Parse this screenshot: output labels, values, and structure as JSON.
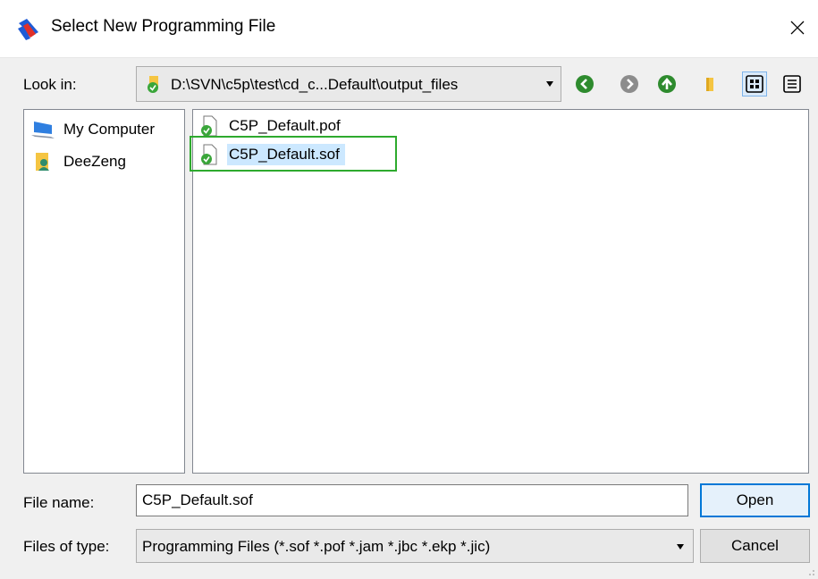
{
  "window": {
    "title": "Select New Programming File",
    "close_icon": "close-icon",
    "app_icon": "programmer-app-icon"
  },
  "toolbar": {
    "look_in_label": "Look in:",
    "look_in_path": "D:\\SVN\\c5p\\test\\cd_c...Default\\output_files",
    "buttons": [
      {
        "name": "back-button",
        "icon": "back-arrow-icon"
      },
      {
        "name": "forward-button",
        "icon": "forward-arrow-icon"
      },
      {
        "name": "up-folder-button",
        "icon": "up-arrow-icon"
      },
      {
        "name": "new-folder-button",
        "icon": "folder-icon"
      },
      {
        "name": "list-view-button",
        "icon": "list-view-icon"
      },
      {
        "name": "detail-view-button",
        "icon": "detail-view-icon"
      }
    ]
  },
  "places": {
    "items": [
      {
        "label": "My Computer",
        "icon": "computer-icon"
      },
      {
        "label": "DeeZeng",
        "icon": "user-folder-icon"
      }
    ]
  },
  "files": {
    "items": [
      {
        "label": "C5P_Default.pof",
        "icon": "file-icon",
        "selected": false
      },
      {
        "label": "C5P_Default.sof",
        "icon": "file-icon",
        "selected": true
      }
    ]
  },
  "form": {
    "file_name_label": "File name:",
    "file_name_value": "C5P_Default.sof",
    "file_type_label": "Files of type:",
    "file_type_value": "Programming Files (*.sof *.pof *.jam *.jbc *.ekp *.jic)"
  },
  "buttons": {
    "open_label": "Open",
    "cancel_label": "Cancel"
  },
  "colors": {
    "accent": "#0078d7",
    "highlight_box": "#2eaa2e",
    "selection": "#cce8ff",
    "nav_icon_green": "#2e8b2e"
  }
}
